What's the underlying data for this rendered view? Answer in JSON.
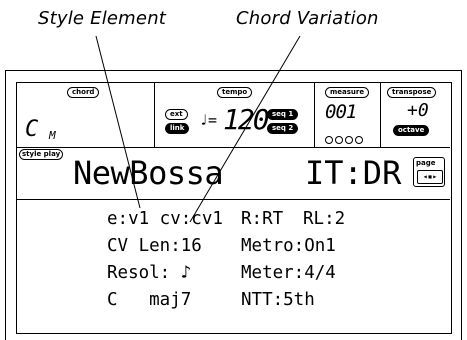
{
  "callouts": {
    "style_element": "Style Element",
    "chord_variation": "Chord Variation"
  },
  "header": {
    "chord_tag": "chord",
    "chord_symbol": "C",
    "chord_sub": "M",
    "tempo_tag": "tempo",
    "ext_label": "ext",
    "link_label": "link",
    "tempo_note": "♩=",
    "tempo_value": "120",
    "seq1_label": "seq 1",
    "seq2_label": "seq 2",
    "measure_tag": "measure",
    "measure_value": "001",
    "transpose_tag": "transpose",
    "transpose_value": "+0",
    "octave_tag": "octave"
  },
  "style_bar": {
    "mode_tag": "style play",
    "style_name": "NewBossa",
    "element": "IT:DR",
    "page_tag": "page"
  },
  "edit": {
    "line1a": "e:v1 cv:cv1",
    "line1b": "R:RT",
    "line1c": "RL:2",
    "line2a": "CV Len:16",
    "line2b": "Metro:On1",
    "line3a": "Resol: ♪",
    "line3b": "Meter:4/4",
    "line4a": "C   maj7",
    "line4b": "NTT:5th"
  }
}
